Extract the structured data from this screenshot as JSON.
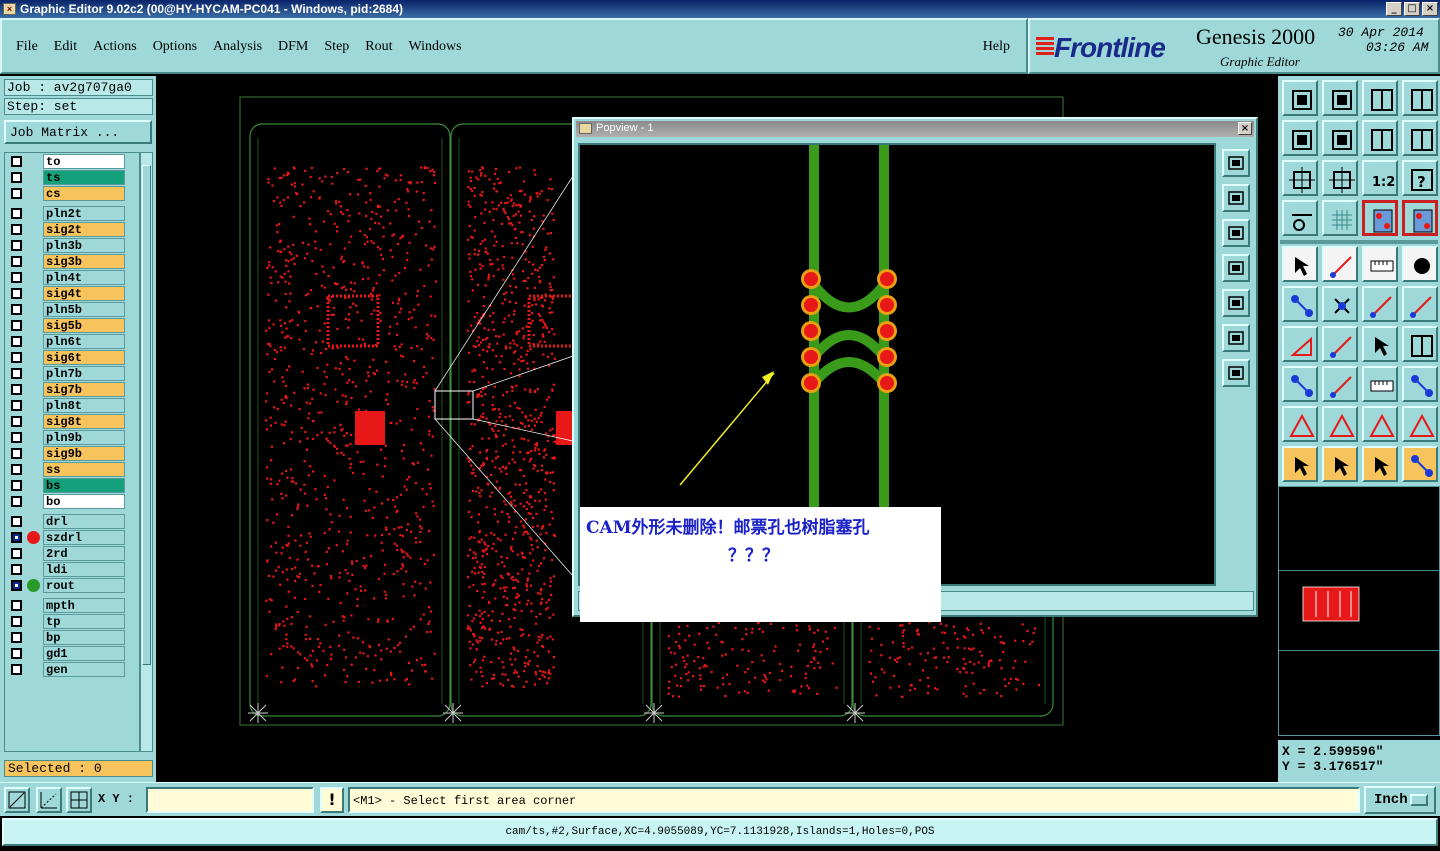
{
  "window": {
    "title": "Graphic Editor 9.02c2 (00@HY-HYCAM-PC041 - Windows, pid:2684)"
  },
  "menu": {
    "items": [
      "File",
      "Edit",
      "Actions",
      "Options",
      "Analysis",
      "DFM",
      "Step",
      "Rout",
      "Windows"
    ],
    "help": "Help"
  },
  "brand": {
    "logo": "Frontline",
    "product": "Genesis 2000",
    "module": "Graphic Editor",
    "date": "30 Apr 2014",
    "time": "03:26 AM"
  },
  "job": {
    "job_label": "Job : av2g707ga0",
    "step_label": "Step: set",
    "matrix_button": "Job Matrix ..."
  },
  "layers": [
    {
      "name": "to",
      "color": "#ffffff",
      "dot": ""
    },
    {
      "name": "ts",
      "color": "#14a07a",
      "dot": ""
    },
    {
      "name": "cs",
      "color": "#f6c35c",
      "dot": ""
    },
    {
      "name": "pln2t",
      "color": "#9ed8d8",
      "dot": ""
    },
    {
      "name": "sig2t",
      "color": "#f6c35c",
      "dot": ""
    },
    {
      "name": "pln3b",
      "color": "#9ed8d8",
      "dot": ""
    },
    {
      "name": "sig3b",
      "color": "#f6c35c",
      "dot": ""
    },
    {
      "name": "pln4t",
      "color": "#9ed8d8",
      "dot": ""
    },
    {
      "name": "sig4t",
      "color": "#f6c35c",
      "dot": ""
    },
    {
      "name": "pln5b",
      "color": "#9ed8d8",
      "dot": ""
    },
    {
      "name": "sig5b",
      "color": "#f6c35c",
      "dot": ""
    },
    {
      "name": "pln6t",
      "color": "#9ed8d8",
      "dot": ""
    },
    {
      "name": "sig6t",
      "color": "#f6c35c",
      "dot": ""
    },
    {
      "name": "pln7b",
      "color": "#9ed8d8",
      "dot": ""
    },
    {
      "name": "sig7b",
      "color": "#f6c35c",
      "dot": ""
    },
    {
      "name": "pln8t",
      "color": "#9ed8d8",
      "dot": ""
    },
    {
      "name": "sig8t",
      "color": "#f6c35c",
      "dot": ""
    },
    {
      "name": "pln9b",
      "color": "#9ed8d8",
      "dot": ""
    },
    {
      "name": "sig9b",
      "color": "#f6c35c",
      "dot": ""
    },
    {
      "name": "ss",
      "color": "#f6c35c",
      "dot": ""
    },
    {
      "name": "bs",
      "color": "#14a07a",
      "dot": ""
    },
    {
      "name": "bo",
      "color": "#ffffff",
      "dot": ""
    },
    {
      "name": "drl",
      "color": "#9ed8d8",
      "dot": ""
    },
    {
      "name": "szdrl",
      "color": "#9ed8d8",
      "dot": "#e81818"
    },
    {
      "name": "2rd",
      "color": "#9ed8d8",
      "dot": ""
    },
    {
      "name": "ldi",
      "color": "#9ed8d8",
      "dot": ""
    },
    {
      "name": "rout",
      "color": "#9ed8d8",
      "dot": "#2a9a2a"
    },
    {
      "name": "mpth",
      "color": "#9ed8d8",
      "dot": ""
    },
    {
      "name": "tp",
      "color": "#9ed8d8",
      "dot": ""
    },
    {
      "name": "bp",
      "color": "#9ed8d8",
      "dot": ""
    },
    {
      "name": "gd1",
      "color": "#9ed8d8",
      "dot": ""
    },
    {
      "name": "gen",
      "color": "#9ed8d8",
      "dot": ""
    }
  ],
  "selected": "Selected : 0",
  "popview": {
    "title": "Popview - 1",
    "annotation_line1": "CAM外形未删除！邮票孔也树脂塞孔",
    "annotation_line2": "？？？"
  },
  "coords": {
    "x": "X = 2.599596\"",
    "y": "Y = 3.176517\""
  },
  "bottom": {
    "xy_label": "X Y :",
    "xy_value": "",
    "warn": "!",
    "prompt": "<M1> - Select first area corner",
    "unit": "Inch"
  },
  "status": "cam/ts,#2,Surface,XC=4.9055089,YC=7.1131928,Islands=1,Holes=0,POS",
  "colors": {
    "feature_red": "#e81818",
    "rout_green": "#3a9a1a",
    "pad_orange": "#e8a010",
    "outline": "#4a8a4a"
  }
}
